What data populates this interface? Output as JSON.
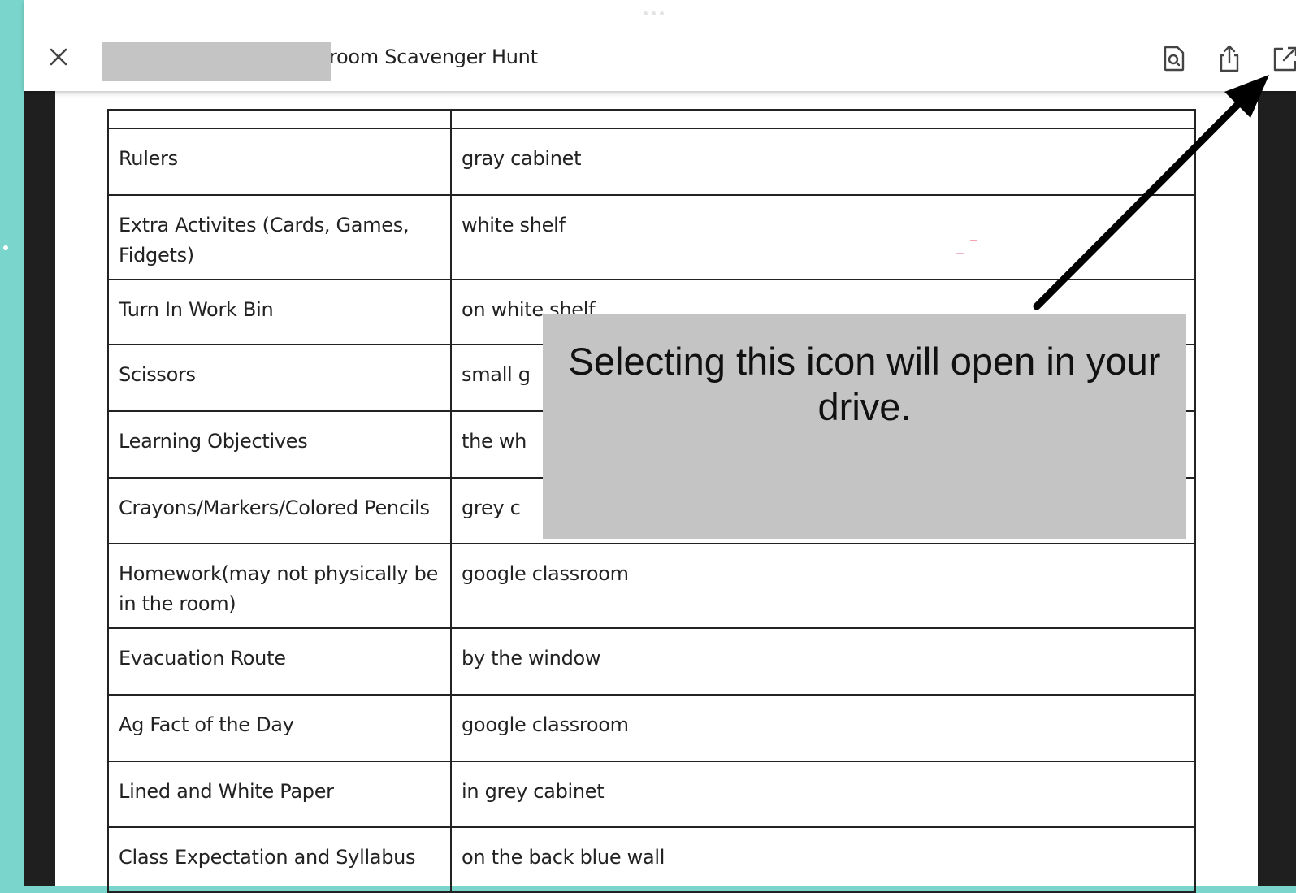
{
  "header": {
    "title": "room Scavenger Hunt",
    "icons": [
      "close-icon",
      "find-in-document-icon",
      "share-icon",
      "open-in-new-icon"
    ]
  },
  "table": {
    "rows": [
      [
        "Rulers",
        "gray cabinet"
      ],
      [
        "Extra Activites (Cards, Games, Fidgets)",
        "white shelf"
      ],
      [
        "Turn In Work Bin",
        "on white shelf"
      ],
      [
        "Scissors",
        "small g"
      ],
      [
        "Learning Objectives",
        "the wh"
      ],
      [
        "Crayons/Markers/Colored Pencils",
        "grey c"
      ],
      [
        "Homework(may not physically be in the room)",
        "google classroom"
      ],
      [
        "Evacuation Route",
        "by the window"
      ],
      [
        "Ag Fact of the Day",
        "google classroom"
      ],
      [
        "Lined and White Paper",
        "in grey cabinet"
      ],
      [
        "Class Expectation and Syllabus",
        "on the back blue wall"
      ]
    ]
  },
  "annotation": {
    "text": "Selecting this icon will open in your drive."
  },
  "colors": {
    "accent_teal": "#7ad6cc",
    "overlay_gray": "#c4c4c4",
    "viewer_dark": "#1f1f1f"
  }
}
